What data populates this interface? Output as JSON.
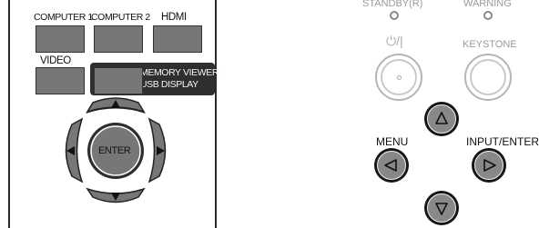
{
  "remote": {
    "computer1_label": "COMPUTER 1",
    "computer2_label": "COMPUTER 2",
    "hdmi_label": "HDMI",
    "video_label": "VIDEO",
    "memory_viewer_label_line1": "MEMORY VIEWER/",
    "memory_viewer_label_line2": "USB DISPLAY",
    "enter_label": "ENTER",
    "up_icon": "triangle-up",
    "down_icon": "triangle-down",
    "left_icon": "triangle-left",
    "right_icon": "triangle-right"
  },
  "projector": {
    "standby_label": "STANDBY(R)",
    "warning_label": "WARNING",
    "power_label": "⏻/|",
    "keystone_label": "KEYSTONE",
    "menu_label": "MENU",
    "input_enter_label": "INPUT/ENTER",
    "up_icon": "triangle-up-outline",
    "down_icon": "triangle-down-outline",
    "left_icon": "triangle-left-outline",
    "right_icon": "triangle-right-outline"
  },
  "colors": {
    "button_gray": "#777777",
    "dark_outline": "#2f2f2f",
    "projector_button": "#888888",
    "indicator_gray": "#8a8a8a"
  }
}
